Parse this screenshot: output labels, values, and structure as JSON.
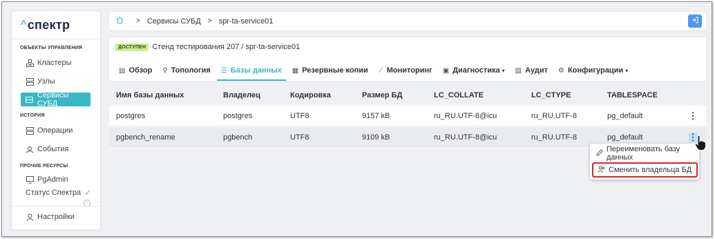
{
  "sidebar": {
    "logo_caret": "^",
    "logo_text": "спектр",
    "section_objects": "ОБЪЕКТЫ УПРАВЛЕНИЯ",
    "items": [
      {
        "label": "Кластеры",
        "icon": "clusters-icon"
      },
      {
        "label": "Узлы",
        "icon": "nodes-icon"
      },
      {
        "label": "Сервисы СУБД",
        "icon": "db-services-icon"
      }
    ],
    "section_history": "ИСТОРИЯ",
    "history_items": [
      {
        "label": "Операции",
        "icon": "operations-icon"
      },
      {
        "label": "События",
        "icon": "events-icon"
      }
    ],
    "section_other": "ПРОЧИЕ РЕСУРСЫ",
    "other_items": [
      {
        "label": "PgAdmin",
        "icon": "pgadmin-icon"
      }
    ],
    "status_label": "Статус Спектра",
    "settings_label": "Настройки"
  },
  "breadcrumb": {
    "items": [
      "Сервисы СУБД",
      "spr-ta-service01"
    ]
  },
  "header": {
    "badge": "ДОСТУПЕН",
    "path": "Стенд тестирования 207 /  spr-ta-service01"
  },
  "tabs": [
    {
      "label": "Обзор",
      "icon": "overview-icon"
    },
    {
      "label": "Топология",
      "icon": "topology-icon"
    },
    {
      "label": "Базы данных",
      "icon": "databases-icon",
      "active": true
    },
    {
      "label": "Резервные копии",
      "icon": "backups-icon"
    },
    {
      "label": "Мониторинг",
      "icon": "monitoring-icon"
    },
    {
      "label": "Диагностика",
      "icon": "diagnostics-icon",
      "dropdown": true
    },
    {
      "label": "Аудит",
      "icon": "audit-icon"
    },
    {
      "label": "Конфигурации",
      "icon": "config-icon",
      "dropdown": true
    }
  ],
  "table": {
    "columns": [
      "Имя базы данных",
      "Владелец",
      "Кодировка",
      "Размер БД",
      "LC_COLLATE",
      "LC_CTYPE",
      "TABLESPACE"
    ],
    "rows": [
      [
        "postgres",
        "postgres",
        "UTF8",
        "9157 kB",
        "ru_RU.UTF-8@icu",
        "ru_RU.UTF-8",
        "pg_default"
      ],
      [
        "pgbench_rename",
        "pgbench",
        "UTF8",
        "9109 kB",
        "ru_RU.UTF-8@icu",
        "ru_RU.UTF-8",
        "pg_default"
      ]
    ]
  },
  "menu": {
    "items": [
      {
        "label": "Переименовать базу данных",
        "icon": "pencil-icon"
      },
      {
        "label": "Сменить владельца БД",
        "icon": "owner-icon",
        "highlighted": true
      }
    ]
  },
  "colors": {
    "accent": "#38b7c6",
    "badge_bg": "#c9f08a",
    "highlight_border": "#d62424",
    "exit_button": "#4a9af0"
  }
}
